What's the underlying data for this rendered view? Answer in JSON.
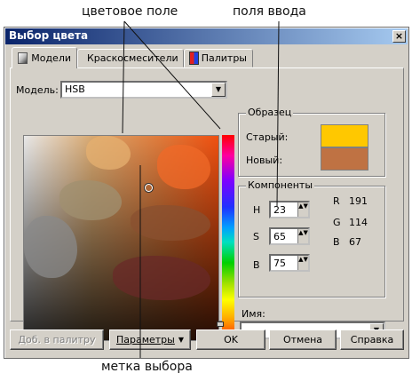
{
  "callouts": {
    "color_field": "цветовое поле",
    "input_fields": "поля ввода",
    "selection_marker": "метка выбора"
  },
  "window": {
    "title": "Выбор цвета",
    "close_glyph": "×"
  },
  "tabs": [
    {
      "label": "Модели",
      "icon": "color-model-icon",
      "active": true
    },
    {
      "label": "Краскосмесители",
      "icon": "color-wheel-icon",
      "active": false
    },
    {
      "label": "Палитры",
      "icon": "palette-icon",
      "active": false
    }
  ],
  "model": {
    "label": "Модель:",
    "value": "HSB",
    "arrow": "▼"
  },
  "sample": {
    "title": "Образец",
    "old_label": "Старый:",
    "new_label": "Новый:",
    "old_color": "#FFC800",
    "new_color": "#BF7243"
  },
  "components": {
    "title": "Компоненты",
    "h": {
      "label": "H",
      "value": "23"
    },
    "s": {
      "label": "S",
      "value": "65"
    },
    "b": {
      "label": "B",
      "value": "75"
    },
    "r": {
      "label": "R",
      "value": "191"
    },
    "g": {
      "label": "G",
      "value": "114"
    },
    "bb": {
      "label": "B",
      "value": "67"
    },
    "spin_glyph": "▲▼"
  },
  "name_field": {
    "label": "Имя:",
    "value": "",
    "arrow": "▼"
  },
  "buttons": {
    "add_to_palette": "Доб. в палитру",
    "params": "Параметры",
    "ok": "OK",
    "cancel": "Отмена",
    "help": "Справка",
    "dropdown_arrow": "▼"
  }
}
